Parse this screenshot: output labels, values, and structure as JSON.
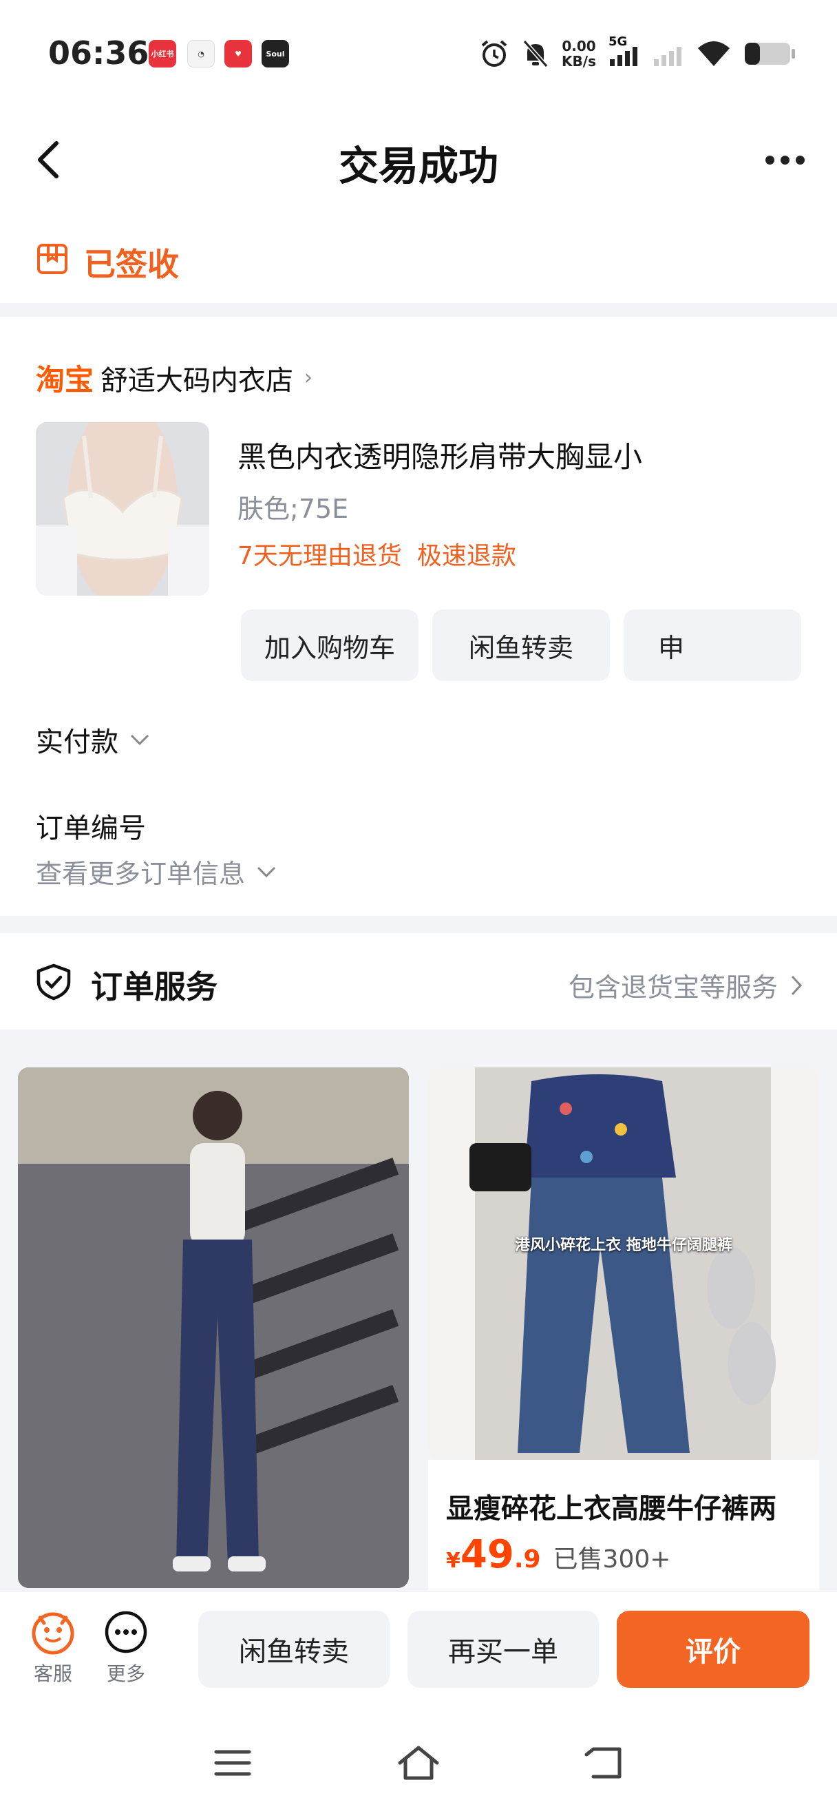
{
  "status_bar": {
    "time": "06:36",
    "net_speed_value": "0.00",
    "net_speed_unit": "KB/s",
    "network": "5G",
    "notification_apps": [
      "小红书",
      "clock",
      "health",
      "Soul"
    ]
  },
  "header": {
    "title": "交易成功"
  },
  "sign_status": "已签收",
  "shop": {
    "brand": "淘宝",
    "name": "舒适大码内衣店"
  },
  "item": {
    "title": "黑色内衣透明隐形肩带大胸显小",
    "spec": "肤色;75E",
    "tags": [
      "7天无理由退货",
      "极速退款"
    ]
  },
  "item_actions": {
    "add_cart": "加入购物车",
    "resell": "闲鱼转卖",
    "apply": "申"
  },
  "payment": {
    "label": "实付款"
  },
  "order": {
    "number_label": "订单编号",
    "more_label": "查看更多订单信息"
  },
  "service": {
    "title": "订单服务",
    "link": "包含退货宝等服务"
  },
  "recommend": {
    "p2": {
      "overlay_text": "港风小碎花上衣  拖地牛仔阔腿裤",
      "title": "显瘦碎花上衣高腰牛仔裤两",
      "price_currency": "¥",
      "price_int": "49",
      "price_dec": ".9",
      "sold": "已售300+"
    }
  },
  "bottom_bar": {
    "service_label": "客服",
    "more_label": "更多",
    "resell": "闲鱼转卖",
    "rebuy": "再买一单",
    "review": "评价"
  },
  "colors": {
    "accent": "#f26522",
    "brand_orange": "#ff5a00",
    "price_red": "#ff4400",
    "muted": "#8a8f99"
  }
}
